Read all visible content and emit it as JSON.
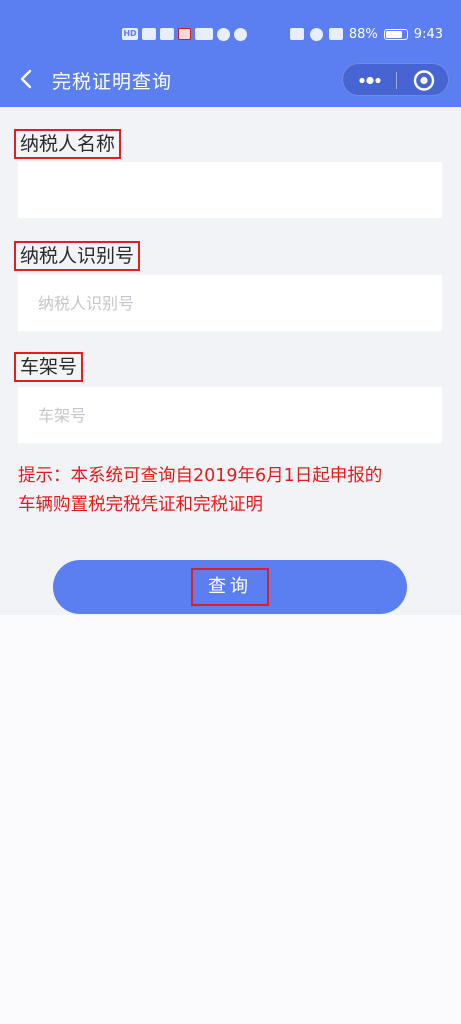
{
  "status_bar": {
    "battery_percent": "88%",
    "time": "9:43",
    "left_icons": [
      "hd-icon",
      "signal-icon",
      "notification-icon",
      "red-app-icon",
      "cloud-icon",
      "pin-icon",
      "browser-icon"
    ],
    "right_icons": [
      "nfc-icon",
      "alarm-icon",
      "vibrate-icon",
      "battery-icon"
    ]
  },
  "nav": {
    "title": "完税证明查询",
    "back_icon": "chevron-left-icon",
    "more_icon": "more-icon",
    "close_icon": "target-icon"
  },
  "form": {
    "fields": [
      {
        "label": "纳税人名称",
        "value": "",
        "placeholder": ""
      },
      {
        "label": "纳税人识别号",
        "value": "",
        "placeholder": "纳税人识别号"
      },
      {
        "label": "车架号",
        "value": "",
        "placeholder": "车架号"
      }
    ],
    "hint_lines": [
      "提示：本系统可查询自2019年6月1日起申报的",
      "车辆购置税完税凭证和完税证明"
    ],
    "submit_label": "查询"
  },
  "colors": {
    "primary": "#5b7ff0",
    "highlight_red": "#e02020",
    "hint_text": "#e41b1b",
    "form_background": "#f2f3f7"
  }
}
